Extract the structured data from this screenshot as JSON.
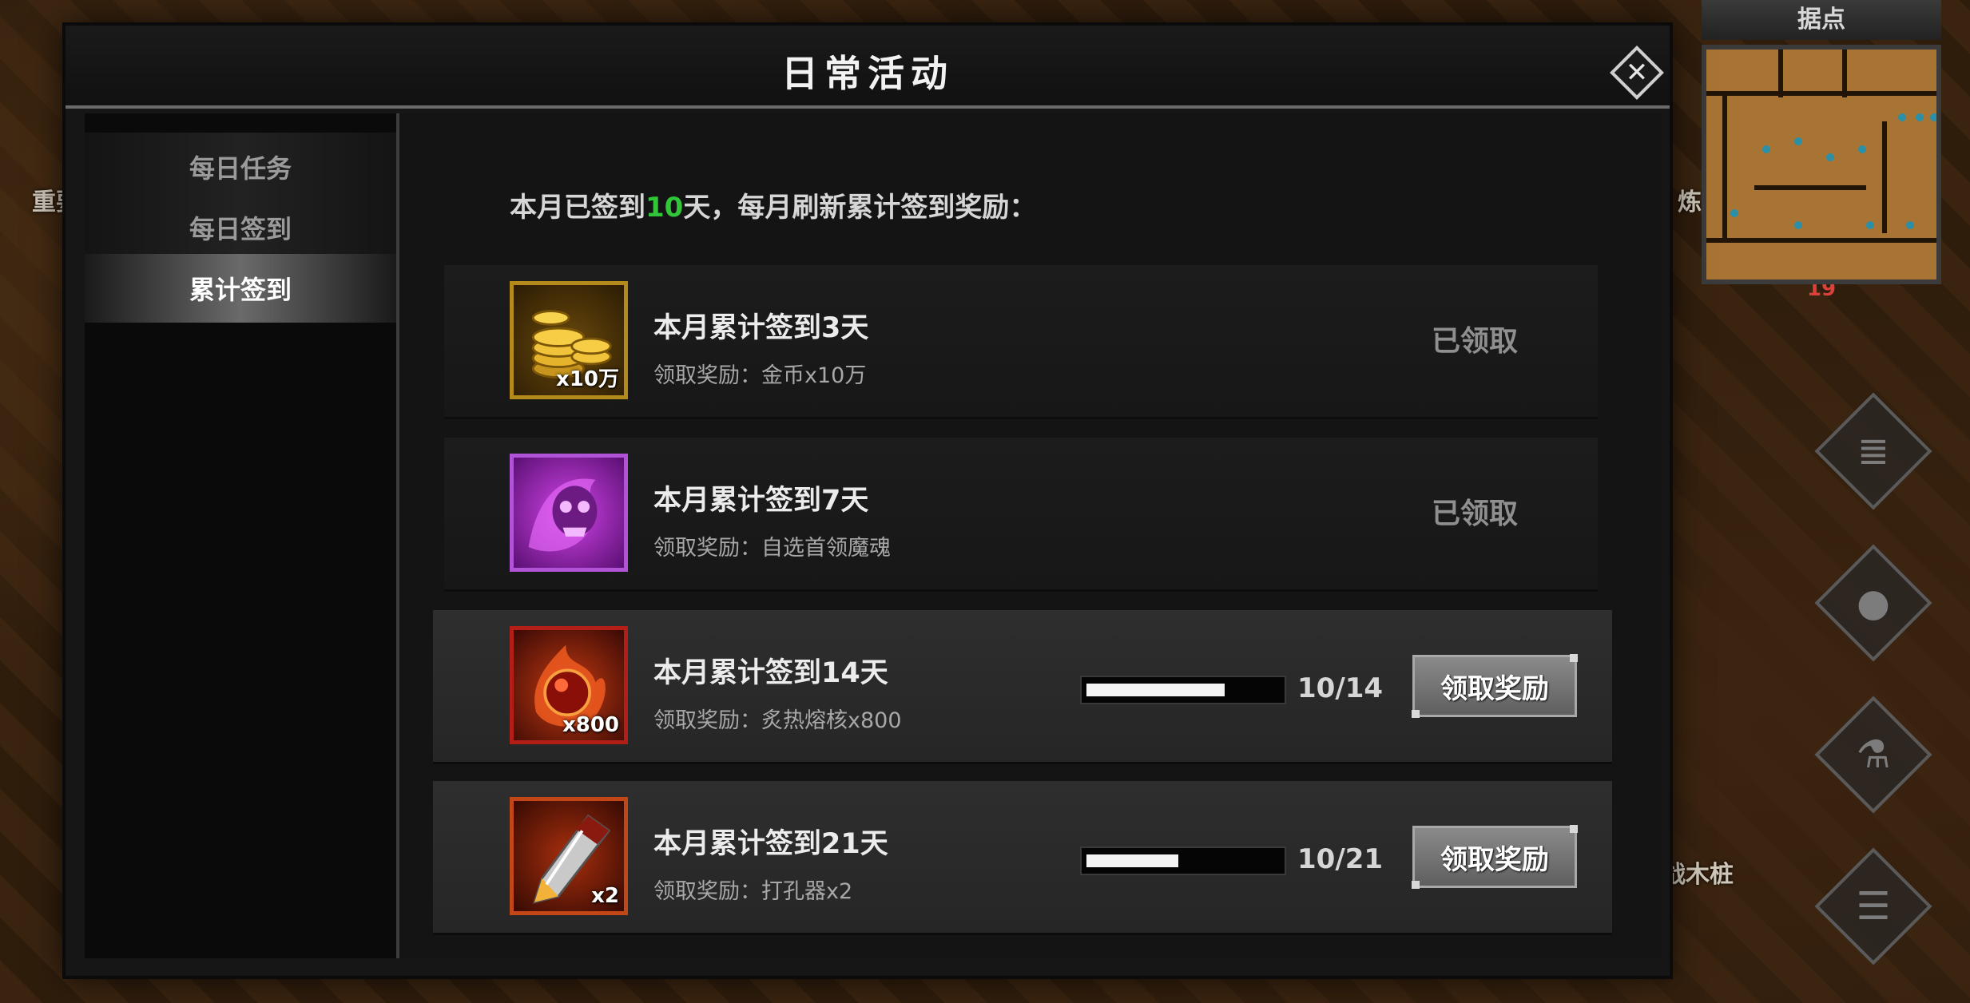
{
  "background": {
    "label_left": "重要",
    "label_right": "炼",
    "label_bottom": "战木桩",
    "badge": "19",
    "minimap_title": "据点",
    "side_buttons": [
      "scroll-icon",
      "users-icon",
      "potion-icon",
      "list-icon"
    ]
  },
  "panel": {
    "title": "日常活动",
    "close_icon": "close-icon"
  },
  "tabs": [
    {
      "label": "每日任务",
      "active": false
    },
    {
      "label": "每日签到",
      "active": false
    },
    {
      "label": "累计签到",
      "active": true
    }
  ],
  "summary": {
    "prefix": "本月已签到",
    "days": "10",
    "suffix": "天，每月刷新累计签到奖励："
  },
  "rewards": [
    {
      "title": "本月累计签到3天",
      "reward": "领取奖励：金币x10万",
      "icon": "gold-coins-icon",
      "qty": "x10万",
      "status": "claimed",
      "status_label": "已领取"
    },
    {
      "title": "本月累计签到7天",
      "reward": "领取奖励：自选首领魔魂",
      "icon": "boss-soul-icon",
      "qty": "",
      "status": "claimed",
      "status_label": "已领取"
    },
    {
      "title": "本月累计签到14天",
      "reward": "领取奖励：炙热熔核x800",
      "icon": "molten-core-icon",
      "qty": "x800",
      "status": "claimable",
      "progress_text": "10/14",
      "progress": 0.714,
      "button_label": "领取奖励"
    },
    {
      "title": "本月累计签到21天",
      "reward": "领取奖励：打孔器x2",
      "icon": "socket-drill-icon",
      "qty": "x2",
      "status": "claimable",
      "progress_text": "10/21",
      "progress": 0.476,
      "button_label": "领取奖励"
    }
  ],
  "colors": {
    "highlight_green": "#31c63a",
    "panel_bg": "#161616",
    "button_gray": "#7a7a7a"
  }
}
